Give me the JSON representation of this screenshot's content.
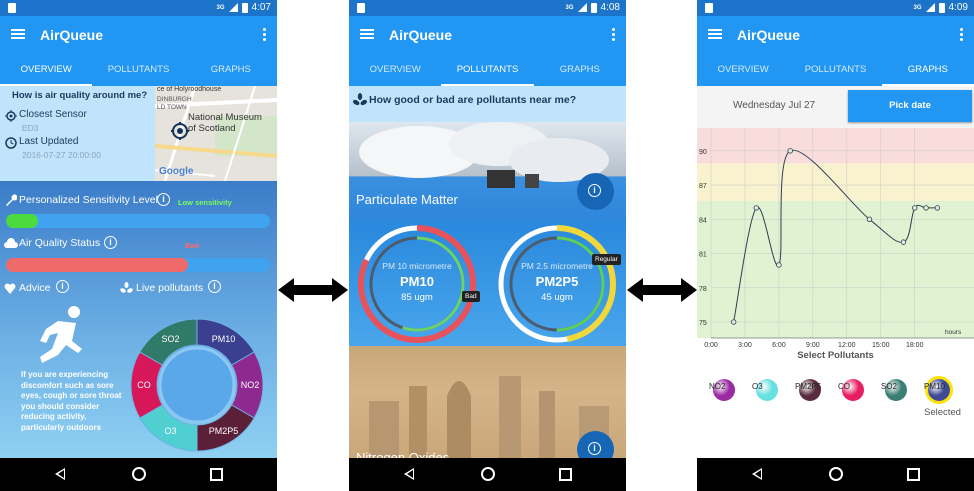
{
  "app": {
    "title": "AirQueue"
  },
  "tabs": [
    "OVERVIEW",
    "POLLUTANTS",
    "GRAPHS"
  ],
  "status_times": [
    "4:07",
    "4:08",
    "4:09"
  ],
  "status_net": "3G",
  "overview": {
    "question": "How is air quality around me?",
    "closest_sensor_label": "Closest Sensor",
    "closest_sensor_value": "ED3",
    "last_updated_label": "Last Updated",
    "last_updated_value": "2016-07-27 20:00:00",
    "map_labels": [
      "ce of Holyroodhouse",
      "DINBURGH",
      "LD TOWN",
      "National Museum",
      "of Scotland",
      "Google"
    ],
    "sensitivity_label": "Personalized Sensitivity Level",
    "sensitivity_value": "Low sensitivity",
    "sensitivity_level": 0.12,
    "aq_status_label": "Air Quality Status",
    "aq_status_value": "Bad",
    "aq_level": 0.69,
    "advice_label": "Advice",
    "live_pollutants_label": "Live pollutants",
    "advice_text": "If you are experiencing discomfort such as sore eyes, cough or sore throat you should consider reducing activity, particularly outdoors",
    "donut": [
      {
        "name": "PM10",
        "color": "#3a3f8f"
      },
      {
        "name": "NO2",
        "color": "#8e2a8f"
      },
      {
        "name": "PM2P5",
        "color": "#5b2038"
      },
      {
        "name": "O3",
        "color": "#4fcfcf"
      },
      {
        "name": "CO",
        "color": "#d6185a"
      },
      {
        "name": "SO2",
        "color": "#2f7a68"
      }
    ]
  },
  "pollutants": {
    "question": "How good or bad are pollutants near me?",
    "card1_title": "Particulate Matter",
    "card2_title": "Nitrogen Oxides",
    "pm10": {
      "desc": "PM 10 micrometre",
      "name": "PM10",
      "value": "85 ugm",
      "badge": "Bad",
      "level": 0.82,
      "color": "#e8525a"
    },
    "pm25": {
      "desc": "PM 2.5 micrometre",
      "name": "PM2P5",
      "value": "45 ugm",
      "badge": "Regular",
      "level": 0.47,
      "color": "#f0d83a"
    }
  },
  "graphs": {
    "date_label": "Wednesday Jul 27",
    "pick_date_label": "Pick date",
    "select_label": "Select Pollutants",
    "selected_label": "Selected",
    "x_unit": "hours",
    "chart_data": {
      "type": "line",
      "x_ticks": [
        "0:00",
        "3:00",
        "6:00",
        "9:00",
        "12:00",
        "15:00",
        "18:00"
      ],
      "y_ticks": [
        75,
        78,
        81,
        84,
        87,
        90
      ],
      "xlim": [
        0,
        22
      ],
      "ylim": [
        73.6,
        92
      ],
      "bands": [
        {
          "from": 73.6,
          "to": 85.6,
          "color": "#dff2d1"
        },
        {
          "from": 85.6,
          "to": 88.9,
          "color": "#f8f2cf"
        },
        {
          "from": 88.9,
          "to": 92,
          "color": "#f9dcdc"
        }
      ],
      "series": [
        {
          "name": "PM10",
          "x": [
            2,
            4,
            6,
            7,
            14,
            17,
            18,
            19,
            20
          ],
          "y": [
            75,
            85,
            80,
            90,
            84,
            82,
            85,
            85,
            85
          ]
        }
      ]
    },
    "pollutant_buttons": [
      {
        "name": "NO2",
        "color": "#9b2aa3"
      },
      {
        "name": "O3",
        "color": "#66e0e0"
      },
      {
        "name": "PM2P5",
        "color": "#5a2c3e"
      },
      {
        "name": "CO",
        "color": "#e81e63"
      },
      {
        "name": "SO2",
        "color": "#3b7f72"
      },
      {
        "name": "PM10",
        "color": "#3f4a95"
      }
    ]
  }
}
